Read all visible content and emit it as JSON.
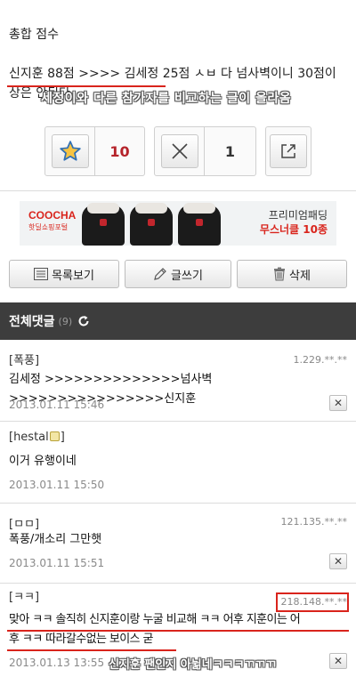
{
  "post": {
    "title": "총합 점수",
    "body": "신지훈 88점 >>>> 김세정 25점 ㅅㅂ 다 넘사벽이니 30점이상은 안된다",
    "annotation": "세정이와 다른 참가자를 비교하는 글이 올라옴"
  },
  "actions": {
    "recommend_count": "10",
    "disagree_count": "1",
    "recommend_icon": "star-icon",
    "disagree_icon": "x-icon",
    "share_icon": "share-icon"
  },
  "banner": {
    "brand": "COOCHA",
    "brand_sub": "핫딜쇼핑포털",
    "line1": "프리미엄패딩",
    "line2_prefix": "무스너클 ",
    "line2_number": "10",
    "line2_suffix": "종"
  },
  "toolbar": {
    "list_label": "목록보기",
    "write_label": "글쓰기",
    "delete_label": "삭제"
  },
  "comments_section": {
    "title": "전체댓글",
    "count": "(9)"
  },
  "comments": [
    {
      "author": "[폭풍]",
      "ip": "1.229.**.**",
      "text": "김세정 >>>>>>>>>>>>>>넘사벽>>>>>>>>>>>>>>>>신지훈",
      "date": "2013.01.11 15:46",
      "delete": "✕"
    },
    {
      "author_prefix": "[hestal",
      "author_suffix": "]",
      "ip": "",
      "text": "이거 유행이네",
      "date": "2013.01.11 15:50",
      "delete": "✕"
    },
    {
      "author": "[ㅁㅁ]",
      "ip": "121.135.**.**",
      "text": "폭풍/개소리 그만햇",
      "date": "2013.01.11 15:51",
      "delete": "✕"
    },
    {
      "author": "[ㅋㅋ]",
      "ip": "218.148.**.**",
      "text_line1": "맞아 ㅋㅋ 솔직히 신지훈이랑 누굴 비교해 ㅋㅋ 어후 지훈이는 어",
      "text_line2": "후 ㅋㅋ 따라갈수없는 보이스 굳",
      "date": "2013.01.13 13:55",
      "delete": "✕"
    }
  ],
  "annotation_bottom": "신지훈 팬인지 아뉢네ㅋㅋㅋㄲㄲㄲ",
  "colors": {
    "accent_red": "#d9241c",
    "count_red": "#b5232a",
    "header_bg": "#3d3d3d"
  }
}
